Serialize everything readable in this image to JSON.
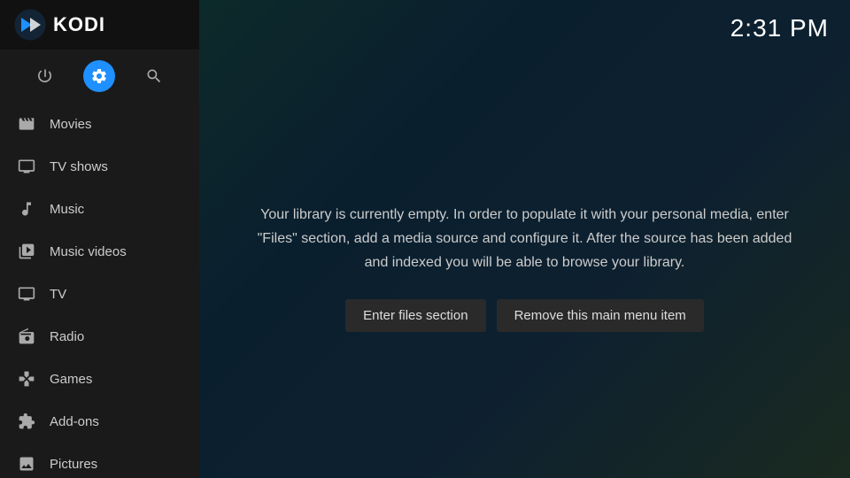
{
  "app": {
    "title": "KODI"
  },
  "time": "2:31 PM",
  "topIcons": [
    {
      "name": "power-icon",
      "label": "⏻",
      "active": false
    },
    {
      "name": "settings-icon",
      "label": "⚙",
      "active": true
    },
    {
      "name": "search-icon",
      "label": "🔍",
      "active": false
    }
  ],
  "sidebar": {
    "items": [
      {
        "id": "movies",
        "label": "Movies",
        "icon": "movies-icon"
      },
      {
        "id": "tv-shows",
        "label": "TV shows",
        "icon": "tv-shows-icon"
      },
      {
        "id": "music",
        "label": "Music",
        "icon": "music-icon"
      },
      {
        "id": "music-videos",
        "label": "Music videos",
        "icon": "music-videos-icon"
      },
      {
        "id": "tv",
        "label": "TV",
        "icon": "tv-icon"
      },
      {
        "id": "radio",
        "label": "Radio",
        "icon": "radio-icon"
      },
      {
        "id": "games",
        "label": "Games",
        "icon": "games-icon"
      },
      {
        "id": "add-ons",
        "label": "Add-ons",
        "icon": "add-ons-icon"
      },
      {
        "id": "pictures",
        "label": "Pictures",
        "icon": "pictures-icon"
      }
    ]
  },
  "main": {
    "message": "Your library is currently empty. In order to populate it with your personal media, enter \"Files\" section, add a media source and configure it. After the source has been added and indexed you will be able to browse your library.",
    "buttons": {
      "enter_files": "Enter files section",
      "remove_item": "Remove this main menu item"
    }
  }
}
